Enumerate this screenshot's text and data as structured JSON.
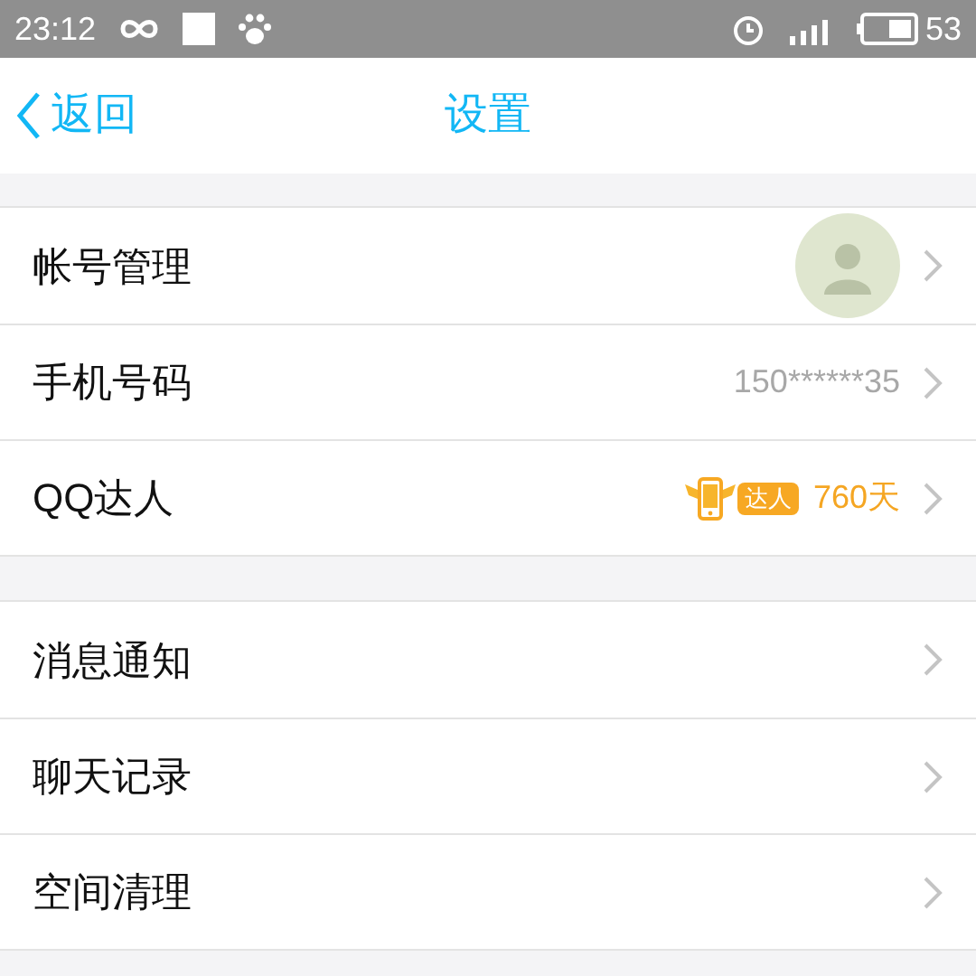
{
  "status_bar": {
    "time": "23:12",
    "battery": "53"
  },
  "header": {
    "back": "返回",
    "title": "设置"
  },
  "sections": [
    {
      "rows": [
        {
          "label": "帐号管理",
          "kind": "avatar"
        },
        {
          "label": "手机号码",
          "kind": "text",
          "value": "150******35"
        },
        {
          "label": "QQ达人",
          "kind": "badge",
          "badge": "达人",
          "value": "760天"
        }
      ]
    },
    {
      "rows": [
        {
          "label": "消息通知",
          "kind": "plain"
        },
        {
          "label": "聊天记录",
          "kind": "plain"
        },
        {
          "label": "空间清理",
          "kind": "plain"
        }
      ]
    }
  ]
}
